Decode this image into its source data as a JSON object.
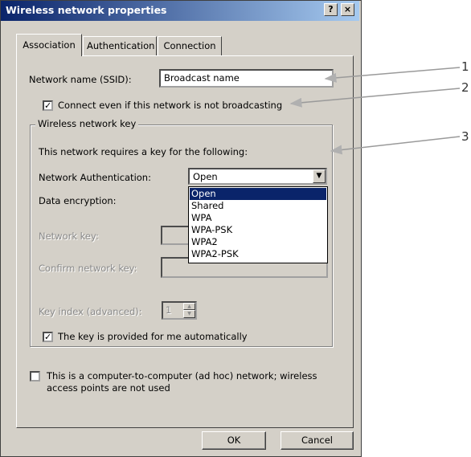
{
  "window": {
    "title": "Wireless network properties",
    "help_glyph": "?",
    "close_glyph": "×"
  },
  "tabs": [
    {
      "label": "Association",
      "active": true
    },
    {
      "label": "Authentication",
      "active": false
    },
    {
      "label": "Connection",
      "active": false
    }
  ],
  "association": {
    "ssid_label": "Network name (SSID):",
    "ssid_value": "Broadcast name",
    "broadcast_check_label": "Connect even if this network is not broadcasting",
    "broadcast_checked": true
  },
  "key_group": {
    "title": "Wireless network key",
    "intro": "This network requires a key for the following:",
    "auth_label": "Network Authentication:",
    "auth_value": "Open",
    "auth_options": [
      "Open",
      "Shared",
      "WPA",
      "WPA-PSK",
      "WPA2",
      "WPA2-PSK"
    ],
    "encryption_label": "Data encryption:",
    "network_key_label": "Network key:",
    "confirm_key_label": "Confirm network key:",
    "key_index_label": "Key index (advanced):",
    "key_index_value": "1",
    "auto_key_label": "The key is provided for me automatically",
    "auto_key_checked": true
  },
  "adhoc": {
    "label_line1": "This is a computer-to-computer (ad hoc) network; wireless",
    "label_line2": "access points are not used",
    "checked": false
  },
  "buttons": {
    "ok": "OK",
    "cancel": "Cancel"
  },
  "callouts": [
    "1",
    "2",
    "3"
  ],
  "colors": {
    "title_start": "#0a246a",
    "title_end": "#a6caf0",
    "face": "#d4d0c8",
    "highlight": "#0a246a"
  }
}
